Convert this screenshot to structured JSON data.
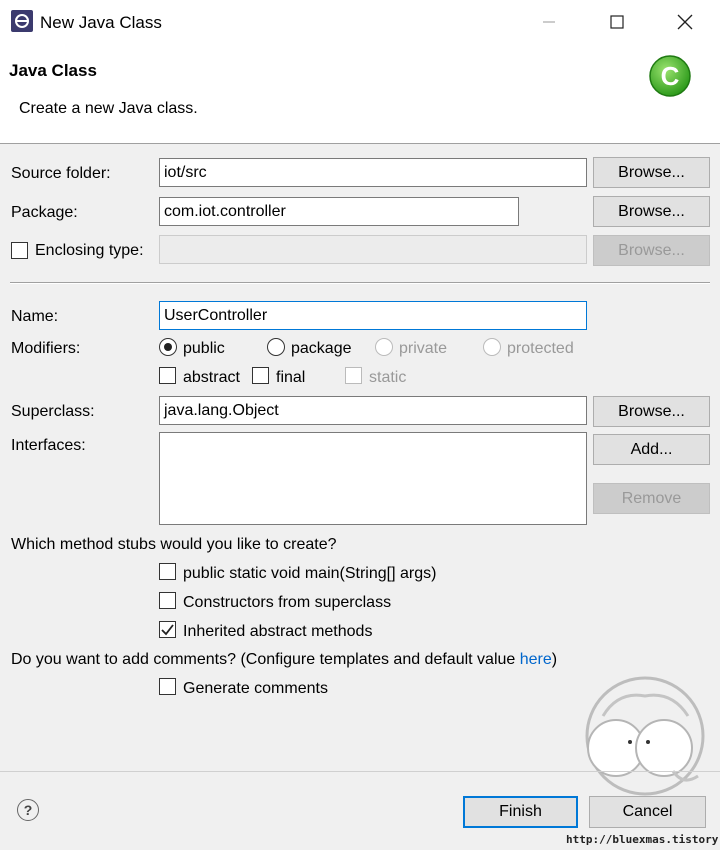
{
  "window": {
    "title": "New Java Class"
  },
  "header": {
    "title": "Java Class",
    "description": "Create a new Java class."
  },
  "labels": {
    "source_folder": "Source folder:",
    "package": "Package:",
    "enclosing_type": "Enclosing type:",
    "name": "Name:",
    "modifiers": "Modifiers:",
    "superclass": "Superclass:",
    "interfaces": "Interfaces:"
  },
  "fields": {
    "source_folder": "iot/src",
    "package": "com.iot.controller",
    "enclosing_type": "",
    "name": "UserController",
    "superclass": "java.lang.Object"
  },
  "buttons": {
    "browse": "Browse...",
    "add": "Add...",
    "remove": "Remove",
    "finish": "Finish",
    "cancel": "Cancel"
  },
  "modifiers": {
    "access": [
      {
        "label": "public",
        "selected": true,
        "enabled": true
      },
      {
        "label": "package",
        "selected": false,
        "enabled": true
      },
      {
        "label": "private",
        "selected": false,
        "enabled": false
      },
      {
        "label": "protected",
        "selected": false,
        "enabled": false
      }
    ],
    "abstract": {
      "label": "abstract",
      "checked": false
    },
    "final": {
      "label": "final",
      "checked": false
    },
    "static": {
      "label": "static",
      "checked": false,
      "enabled": false
    }
  },
  "stubs": {
    "question": "Which method stubs would you like to create?",
    "main": {
      "label": "public static void main(String[] args)",
      "checked": false
    },
    "constructors": {
      "label": "Constructors from superclass",
      "checked": false
    },
    "inherited": {
      "label": "Inherited abstract methods",
      "checked": true
    }
  },
  "comments": {
    "question": "Do you want to add comments? (Configure templates and default value ",
    "link": "here",
    "close_paren": ")",
    "generate": {
      "label": "Generate comments",
      "checked": false
    }
  },
  "watermark": {
    "url": "http://bluexmas.tistory.com/"
  },
  "colors": {
    "accent": "#0078d7",
    "link": "#0066cc",
    "logo": "#3fae2a"
  }
}
